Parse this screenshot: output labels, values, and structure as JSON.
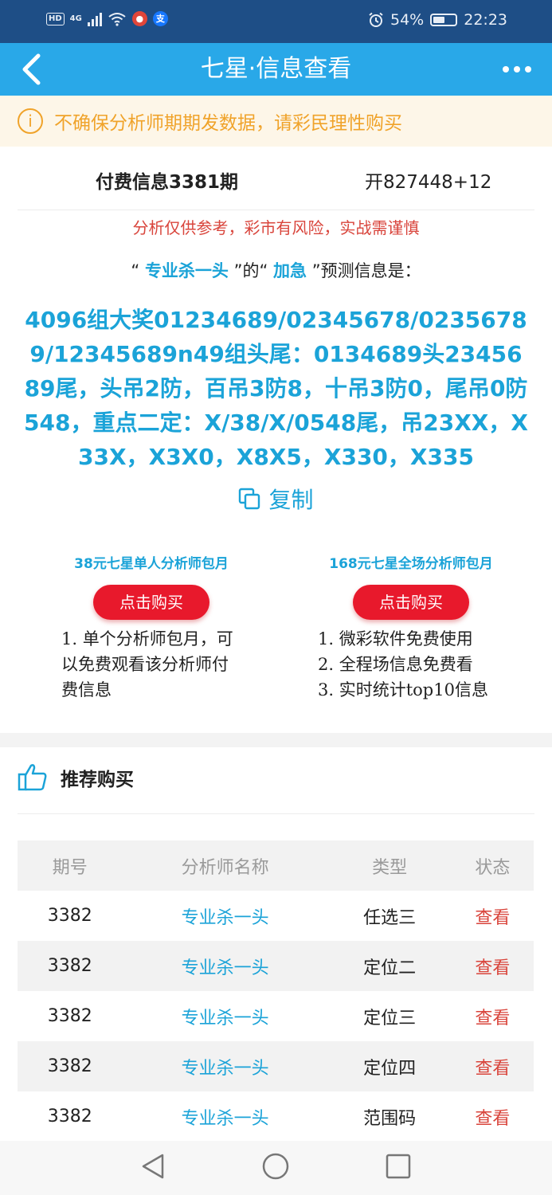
{
  "status_bar": {
    "battery": "54%",
    "time": "22:23",
    "network": "4G",
    "hd": "HD"
  },
  "header": {
    "title": "七星·信息查看"
  },
  "notice": {
    "text": "不确保分析师期期发数据，请彩民理性购买"
  },
  "info": {
    "period": "付费信息3381期",
    "result": "开827448+12",
    "risk": "分析仅供参考，彩市有风险，实战需谨慎",
    "intro_q1": "“ ",
    "analyst": "专业杀一头",
    "intro_q2": " ”的“ ",
    "category": "加急",
    "intro_q3": " ”预测信息是："
  },
  "prediction": "4096组大奖01234689/02345678/02356789/12345689n49组头尾：0134689头2345689尾，头吊2防，百吊3防8，十吊3防0，尾吊0防548，重点二定：X/38/X/0548尾，吊23XX，X33X，X3X0，X8X5，X330，X335",
  "copy_label": "复制",
  "packages": [
    {
      "title": "38元七星单人分析师包月",
      "button": "点击购买",
      "desc": "1. 单个分析师包月，可以免费观看该分析师付费信息"
    },
    {
      "title": "168元七星全场分析师包月",
      "button": "点击购买",
      "desc1": "1. 微彩软件免费使用",
      "desc2": "2. 全程场信息免费看",
      "desc3": "3. 实时统计top10信息"
    }
  ],
  "recommend": {
    "title": "推荐购买",
    "columns": [
      "期号",
      "分析师名称",
      "类型",
      "状态"
    ],
    "rows": [
      {
        "period": "3382",
        "analyst": "专业杀一头",
        "type": "任选三",
        "status": "查看"
      },
      {
        "period": "3382",
        "analyst": "专业杀一头",
        "type": "定位二",
        "status": "查看"
      },
      {
        "period": "3382",
        "analyst": "专业杀一头",
        "type": "定位三",
        "status": "查看"
      },
      {
        "period": "3382",
        "analyst": "专业杀一头",
        "type": "定位四",
        "status": "查看"
      },
      {
        "period": "3382",
        "analyst": "专业杀一头",
        "type": "范围码",
        "status": "查看"
      }
    ]
  },
  "colors": {
    "title_bar": "#29a8e8",
    "status_bar": "#1e4e86",
    "accent": "#1ba3d8",
    "buy_button": "#e8192c",
    "notice": "#f0a32a",
    "link_red": "#d9453c"
  }
}
